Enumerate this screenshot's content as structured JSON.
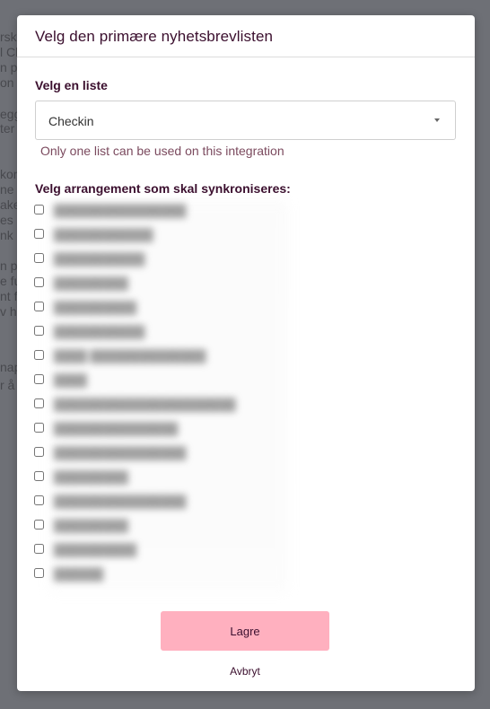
{
  "background": {
    "fragments": [
      "rsk",
      "l Cl",
      "n p",
      "on",
      "egg",
      "ter",
      "kon",
      "ne",
      "ake",
      "es",
      "nk",
      "n p",
      "e fu",
      "nt fo",
      "v h",
      "nap",
      "r å"
    ]
  },
  "modal": {
    "title": "Velg den primære nyhetsbrevlisten",
    "list_section_label": "Velg en liste",
    "list_select": {
      "value": "Checkin"
    },
    "help_text": "Only one list can be used on this integration",
    "events_label": "Velg arrangement som skal synkroniseres:",
    "events": [
      {
        "name": "████████████████",
        "checked": false
      },
      {
        "name": "████████████",
        "checked": false
      },
      {
        "name": "███████████",
        "checked": false
      },
      {
        "name": "█████████",
        "checked": false
      },
      {
        "name": "██████████",
        "checked": false
      },
      {
        "name": "███████████",
        "checked": false
      },
      {
        "name": "████  ██████████████",
        "checked": false
      },
      {
        "name": "████",
        "checked": false
      },
      {
        "name": "██████████████████████",
        "checked": false
      },
      {
        "name": "███████████████",
        "checked": false
      },
      {
        "name": "████████████████",
        "checked": false
      },
      {
        "name": "█████████",
        "checked": false
      },
      {
        "name": "████████████████",
        "checked": false
      },
      {
        "name": "█████████",
        "checked": false
      },
      {
        "name": "██████████",
        "checked": false
      },
      {
        "name": "██████",
        "checked": false
      }
    ],
    "save_label": "Lagre",
    "cancel_label": "Avbryt"
  },
  "colors": {
    "overlay": "#6e7076",
    "title_text": "#3b0f2e",
    "save_button_bg": "#ffb0bf",
    "help_text": "#7b4a5e"
  }
}
